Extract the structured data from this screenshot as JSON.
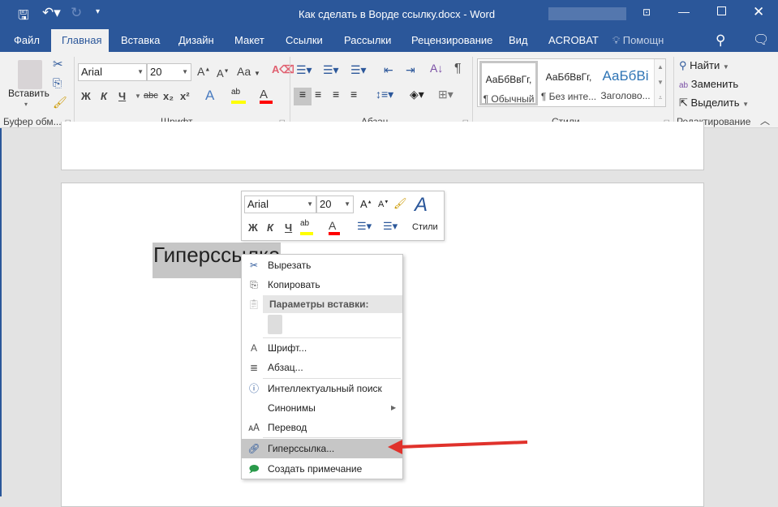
{
  "window": {
    "title": "Как сделать в Ворде ссылку.docx - Word"
  },
  "tabs": [
    "Файл",
    "Главная",
    "Вставка",
    "Дизайн",
    "Макет",
    "Ссылки",
    "Рассылки",
    "Рецензирование",
    "Вид",
    "ACROBAT"
  ],
  "tell_me": "Помощн",
  "ribbon": {
    "clipboard": {
      "paste": "Вставить",
      "label": "Буфер обм..."
    },
    "font": {
      "name": "Arial",
      "size": "20",
      "label": "Шрифт",
      "bold": "Ж",
      "italic": "К",
      "underline": "Ч",
      "strike": "abc",
      "sub": "x₂",
      "sup": "x²",
      "case": "Aa"
    },
    "paragraph": {
      "label": "Абзац"
    },
    "styles": {
      "label": "Стили",
      "items": [
        {
          "preview": "АаБбВвГг,",
          "name": "¶ Обычный"
        },
        {
          "preview": "АаБбВвГг,",
          "name": "¶ Без инте..."
        },
        {
          "preview": "АаБбВі",
          "name": "Заголово..."
        }
      ]
    },
    "editing": {
      "label": "Редактирование",
      "find": "Найти",
      "replace": "Заменить",
      "select": "Выделить"
    }
  },
  "document": {
    "selected_text": "Гиперссылка"
  },
  "mini_toolbar": {
    "font": "Arial",
    "size": "20",
    "bold": "Ж",
    "italic": "К",
    "underline": "Ч",
    "styles": "Стили"
  },
  "context_menu": {
    "cut": "Вырезать",
    "copy": "Копировать",
    "paste_options": "Параметры вставки:",
    "font": "Шрифт...",
    "paragraph": "Абзац...",
    "smart_lookup": "Интеллектуальный поиск",
    "synonyms": "Синонимы",
    "translate": "Перевод",
    "hyperlink": "Гиперссылка...",
    "comment": "Создать примечание"
  },
  "colors": {
    "brand": "#2b579a",
    "highlight": "#ffff00",
    "font_color": "#ff0000",
    "arrow": "#e0322c"
  }
}
